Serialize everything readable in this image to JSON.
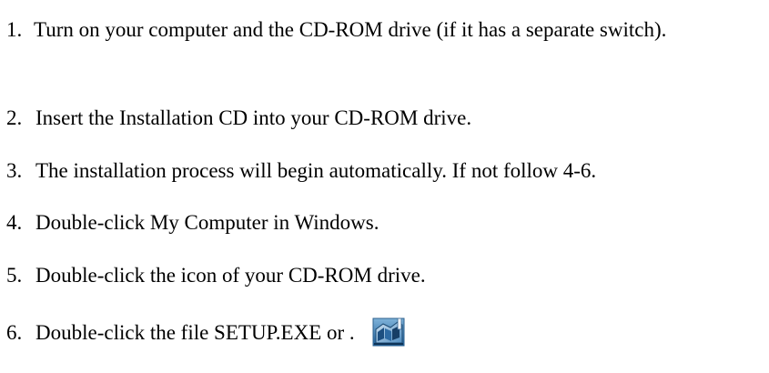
{
  "steps": [
    {
      "num": "1.",
      "text": "Turn on your computer and the CD-ROM drive (if it has a separate switch)."
    },
    {
      "num": "2.",
      "text": "Insert the Installation CD into your CD-ROM drive."
    },
    {
      "num": "3.",
      "text": "The installation process will begin automatically. If not follow 4-6."
    },
    {
      "num": "4.",
      "text": "Double-click My Computer in Windows."
    },
    {
      "num": "5.",
      "text": "Double-click the icon of your CD-ROM drive."
    },
    {
      "num": "6.",
      "text": "Double-click the file SETUP.EXE or  ."
    }
  ],
  "icons": {
    "setup_icon": "setup-installer-icon"
  }
}
